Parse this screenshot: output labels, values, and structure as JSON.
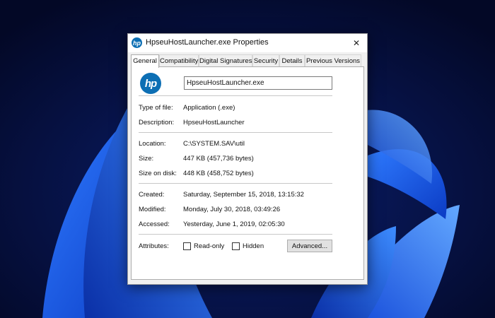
{
  "window": {
    "title": "HpseuHostLauncher.exe Properties",
    "icon": "hp-logo-icon",
    "close_glyph": "✕"
  },
  "tabs": [
    {
      "label": "General",
      "active": true
    },
    {
      "label": "Compatibility"
    },
    {
      "label": "Digital Signatures"
    },
    {
      "label": "Security"
    },
    {
      "label": "Details"
    },
    {
      "label": "Previous Versions"
    }
  ],
  "general": {
    "logo_text": "hp",
    "file_name": "HpseuHostLauncher.exe",
    "type_label": "Type of file:",
    "type_value": "Application (.exe)",
    "description_label": "Description:",
    "description_value": "HpseuHostLauncher",
    "location_label": "Location:",
    "location_value": "C:\\SYSTEM.SAV\\util",
    "size_label": "Size:",
    "size_value": "447 KB (457,736 bytes)",
    "size_on_disk_label": "Size on disk:",
    "size_on_disk_value": "448 KB (458,752 bytes)",
    "created_label": "Created:",
    "created_value": "Saturday, September 15, 2018, 13:15:32",
    "modified_label": "Modified:",
    "modified_value": "Monday, July 30, 2018, 03:49:26",
    "accessed_label": "Accessed:",
    "accessed_value": "Yesterday, June 1, 2019, 02:05:30",
    "attributes_label": "Attributes:",
    "read_only_label": "Read-only",
    "read_only_checked": false,
    "hidden_label": "Hidden",
    "hidden_checked": false,
    "advanced_button": "Advanced..."
  },
  "colors": {
    "hp_blue": "#0d6fb4",
    "wallpaper_bg": "#050c33",
    "wallpaper_bloom": "#1a5cf0"
  }
}
